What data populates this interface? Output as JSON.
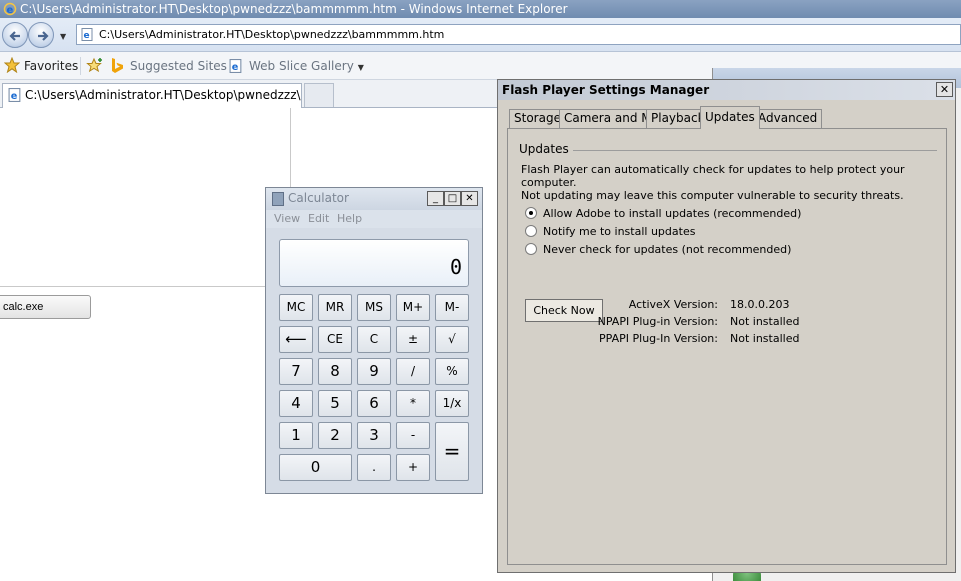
{
  "ie": {
    "title": "C:\\Users\\Administrator.HT\\Desktop\\pwnedzzz\\bammmmm.htm - Windows Internet Explorer",
    "address": "C:\\Users\\Administrator.HT\\Desktop\\pwnedzzz\\bammmmm.htm",
    "favorites_label": "Favorites",
    "suggested_sites": "Suggested Sites",
    "web_slice_gallery": "Web Slice Gallery",
    "tab_label": "C:\\Users\\Administrator.HT\\Desktop\\pwnedzzz\\bamm..."
  },
  "page": {
    "calc_button_label": "calc.exe"
  },
  "calculator": {
    "title": "Calculator",
    "menu": [
      "View",
      "Edit",
      "Help"
    ],
    "display": "0",
    "keys": {
      "mc": "MC",
      "mr": "MR",
      "ms": "MS",
      "mplus": "M+",
      "mminus": "M-",
      "back": "⟵",
      "ce": "CE",
      "c": "C",
      "plusminus": "±",
      "sqrt": "√",
      "k7": "7",
      "k8": "8",
      "k9": "9",
      "div": "/",
      "pct": "%",
      "k4": "4",
      "k5": "5",
      "k6": "6",
      "mul": "*",
      "recip": "1/x",
      "k1": "1",
      "k2": "2",
      "k3": "3",
      "sub": "-",
      "eq": "=",
      "k0": "0",
      "dot": ".",
      "add": "+"
    }
  },
  "flash": {
    "title": "Flash Player Settings Manager",
    "tabs": [
      "Storage",
      "Camera and Mic",
      "Playback",
      "Updates",
      "Advanced"
    ],
    "active_tab": "Updates",
    "group_label": "Updates",
    "description_line1": "Flash Player can automatically check for updates to help protect your computer.",
    "description_line2": "Not updating may leave this computer vulnerable to security threats.",
    "options": [
      {
        "label": "Allow Adobe to install updates (recommended)",
        "selected": true
      },
      {
        "label": "Notify me to install updates",
        "selected": false
      },
      {
        "label": "Never check for updates (not recommended)",
        "selected": false
      }
    ],
    "check_now": "Check Now",
    "versions": [
      {
        "label": "ActiveX Version:",
        "value": "18.0.0.203"
      },
      {
        "label": "NPAPI Plug-in Version:",
        "value": "Not installed"
      },
      {
        "label": "PPAPI Plug-In Version:",
        "value": "Not installed"
      }
    ]
  }
}
